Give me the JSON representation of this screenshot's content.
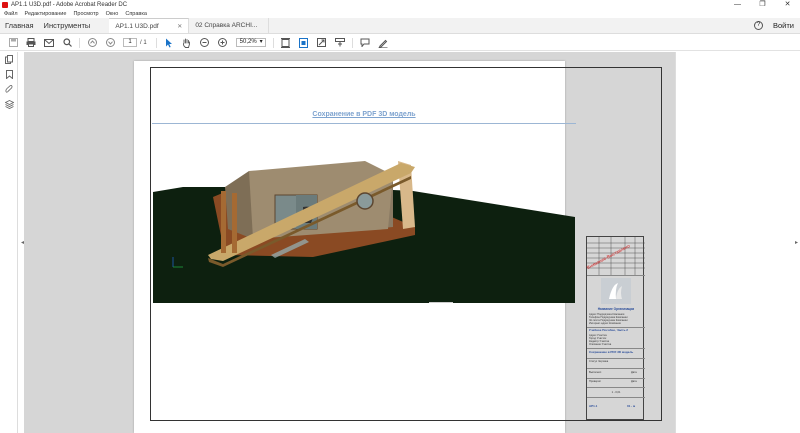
{
  "window": {
    "title": "AP1.1 U3D.pdf - Adobe Acrobat Reader DC",
    "controls": [
      "—",
      "❐",
      "✕"
    ]
  },
  "menu": [
    "Файл",
    "Редактирование",
    "Просмотр",
    "Окно",
    "Справка"
  ],
  "tabs": {
    "home": "Главная",
    "tools": "Инструменты",
    "documents": [
      {
        "label": "AP1.1 U3D.pdf",
        "active": true
      },
      {
        "label": "02 Справка ARCHI...",
        "active": false
      }
    ],
    "signin": "Войти"
  },
  "toolbar": {
    "page_current": "1",
    "page_total": "/ 1",
    "zoom": "50,2%"
  },
  "document": {
    "title": "Сохранение в PDF 3D модель",
    "stamp": {
      "watermark": "Внимание-Выставлено",
      "organization": "Название Организации",
      "org_lines": [
        "Адрес Подрядчика Компании",
        "Телефон Подрядчика Компании",
        "Эл.почта Подрядчика Компании",
        "Интернет-адрес Компании"
      ],
      "project": "Учебное Пособие, Часть 2",
      "project_lines": [
        "Адрес Участка",
        "Город Участок",
        "Кадастр Участка",
        "Описание Участка"
      ],
      "sheet_caption": "Сохранение в PDF 3D модель",
      "sheet_id": "AP1.1",
      "scale": "01 - м",
      "status": "Статус Чертежа",
      "designed": "Выполнил",
      "checked": "Проверил",
      "date": "Дата",
      "date_value": "1 - 0,01"
    }
  }
}
